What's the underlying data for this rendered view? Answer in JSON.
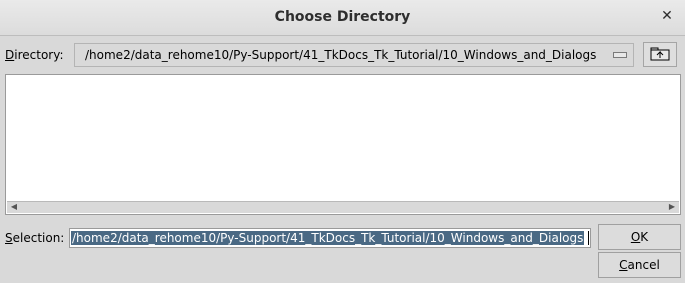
{
  "window": {
    "title": "Choose Directory"
  },
  "directory": {
    "label_mnemonic": "D",
    "label_rest": "irectory:",
    "path": "/home2/data_rehome10/Py-Support/41_TkDocs_Tk_Tutorial/10_Windows_and_Dialogs"
  },
  "file_list": {
    "items": []
  },
  "selection": {
    "label_mnemonic": "S",
    "label_rest": "election:",
    "value": "/home2/data_rehome10/Py-Support/41_TkDocs_Tk_Tutorial/10_Windows_and_Dialogs"
  },
  "buttons": {
    "ok_mnemonic": "O",
    "ok_rest": "K",
    "cancel_mnemonic": "C",
    "cancel_rest": "ancel"
  },
  "icons": {
    "close": "close-icon",
    "parent_dir": "folder-up-icon",
    "scroll_left": "arrow-left-icon",
    "scroll_right": "arrow-right-icon"
  }
}
